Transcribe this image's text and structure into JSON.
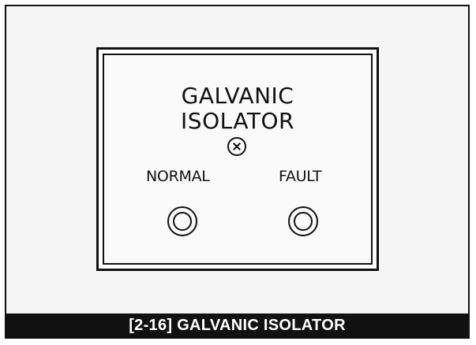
{
  "panel": {
    "title_line_1": "GALVANIC",
    "title_line_2": "ISOLATOR",
    "indicators": [
      {
        "label": "NORMAL"
      },
      {
        "label": "FAULT"
      }
    ],
    "screw_icon": "screw-head-icon"
  },
  "caption": "[2-16] GALVANIC ISOLATOR"
}
